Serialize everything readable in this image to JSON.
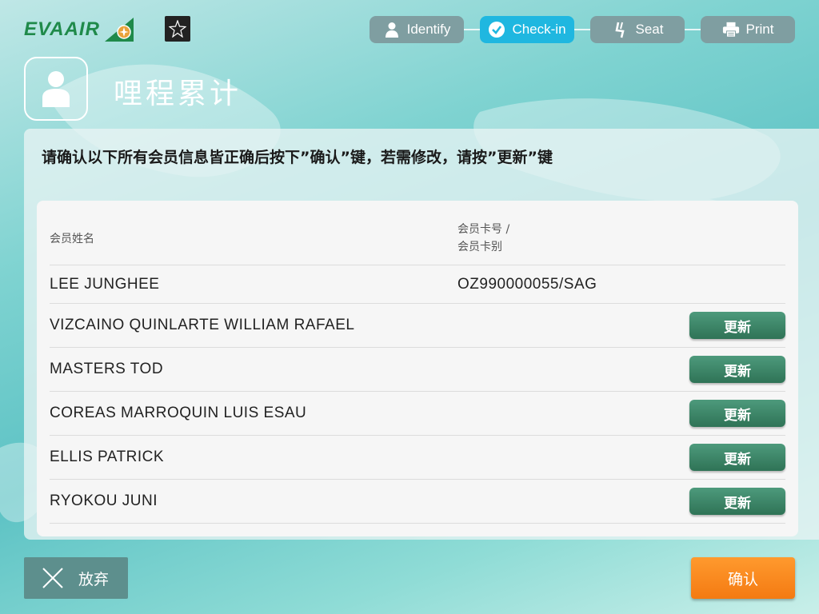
{
  "brand": {
    "logo_text": "EVAAIR",
    "green": "#1f8a4a",
    "accent_blue": "#1fb7e0",
    "orange": "#f47a12"
  },
  "steps": [
    {
      "label": "Identify",
      "icon": "person-icon",
      "active": false
    },
    {
      "label": "Check-in",
      "icon": "checkmark-icon",
      "active": true
    },
    {
      "label": "Seat",
      "icon": "seat-icon",
      "active": false
    },
    {
      "label": "Print",
      "icon": "printer-icon",
      "active": false
    }
  ],
  "page": {
    "title": "哩程累计",
    "instruction": "请确认以下所有会员信息皆正确后按下”确认”键，若需修改，请按”更新”键"
  },
  "table": {
    "col_name": "会员姓名",
    "col_card_line1": "会员卡号 /",
    "col_card_line2": "会员卡别",
    "rows": [
      {
        "name": "LEE JUNGHEE",
        "card": "OZ990000055/SAG",
        "button": ""
      },
      {
        "name": "VIZCAINO QUINLARTE WILLIAM RAFAEL",
        "card": "",
        "button": "更新"
      },
      {
        "name": "MASTERS TOD",
        "card": "",
        "button": "更新"
      },
      {
        "name": "COREAS MARROQUIN LUIS ESAU",
        "card": "",
        "button": "更新"
      },
      {
        "name": "ELLIS PATRICK",
        "card": "",
        "button": "更新"
      },
      {
        "name": "RYOKOU JUNI",
        "card": "",
        "button": "更新"
      }
    ]
  },
  "footer": {
    "discard_label": "放弃",
    "confirm_label": "确认"
  }
}
